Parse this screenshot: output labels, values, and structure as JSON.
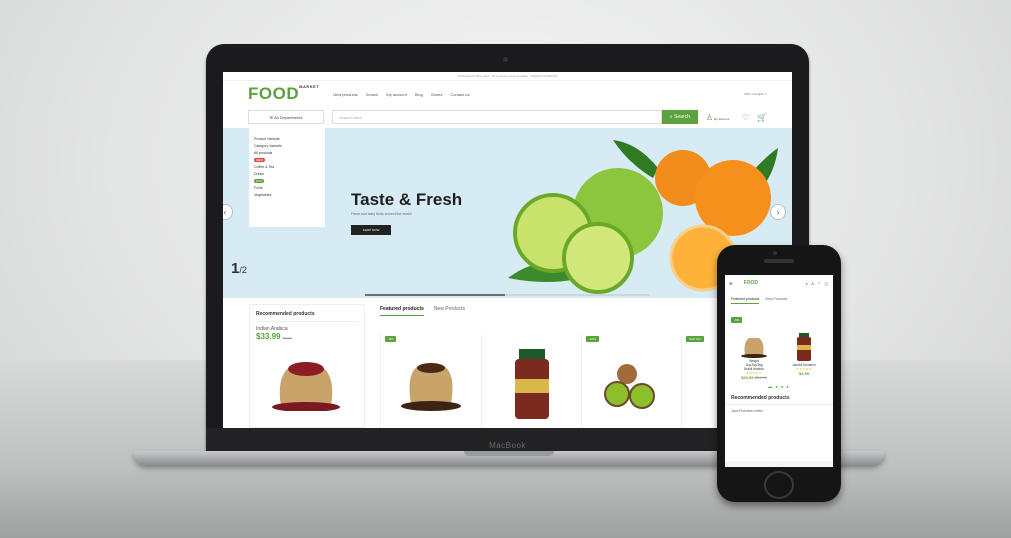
{
  "topbar": {
    "text": "Professional office desc · Ecommerce store-template · Shipping Worldwide"
  },
  "header": {
    "logo": "FOOD",
    "logo_sub": "MARKET",
    "nav": [
      "New products",
      "Search",
      "My account",
      "Blog",
      "Stores",
      "Contact us"
    ],
    "right": "USD ∨   English ∨"
  },
  "search": {
    "dept_label": "☰ All Departments",
    "placeholder": "Search store",
    "button": "Search",
    "account": "My account"
  },
  "menu": {
    "items": [
      "Product Variants",
      "Category Variants",
      "All products",
      "Coffee & Tea",
      "Drinks",
      "Fruits",
      "Vegetables"
    ],
    "tag_new": "NEW",
    "tag_hot": "HOT"
  },
  "hero": {
    "title": "Taste & Fresh",
    "subtitle": "Fresh and tasty fruits around the world!",
    "button": "SHOP NOW",
    "pager_current": "1",
    "pager_total": "/2"
  },
  "recommended": {
    "title": "Recommended products",
    "product_name": "Indian Arabica",
    "price": "$33.99",
    "old_price": "$39.99"
  },
  "featured": {
    "tab_featured": "Featured products",
    "tab_new": "New Products",
    "badges": [
      "-5%",
      "-10%",
      "Sold Out"
    ]
  },
  "brand": "MacBook",
  "phone": {
    "logo": "FOOD",
    "tab_featured": "Featured products",
    "tab_new": "New Products",
    "badge": "-5%",
    "items": [
      {
        "variant": "Weight",
        "opts": "1kg  2kg  5kg",
        "name": "Brazil Arabica",
        "stars": "★★★★★",
        "price": "$20.99",
        "old": "$24.99"
      },
      {
        "variant": "",
        "opts": "",
        "name": "Jacobs Monarch",
        "stars": "★★★★★",
        "price": "$4.99",
        "old": ""
      }
    ],
    "dots": "▬ ● ● ●",
    "recommended": "Recommended products",
    "rec_item": "Java Robusta coffee"
  }
}
